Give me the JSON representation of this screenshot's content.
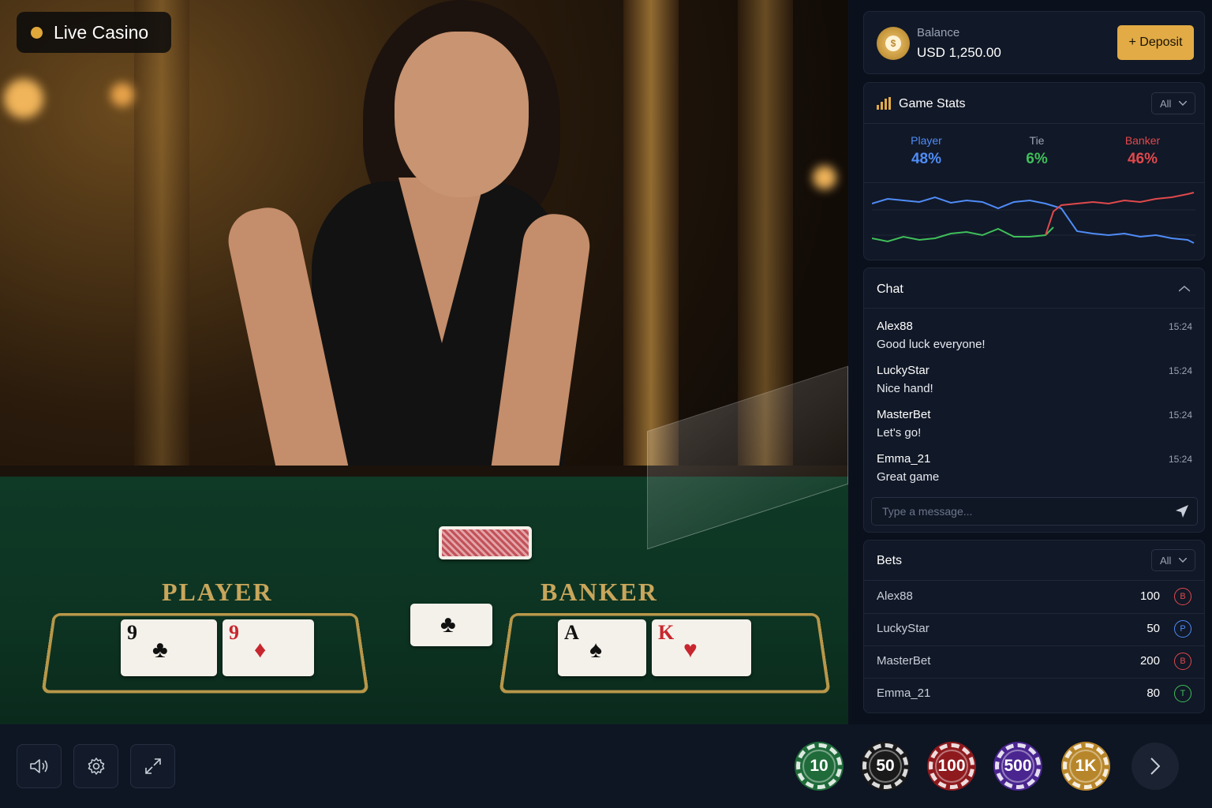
{
  "badge": {
    "label": "Live Casino",
    "dot_color": "#e0a83a"
  },
  "table": {
    "player_label": "PLAYER",
    "banker_label": "BANKER",
    "player_cards": [
      {
        "rank": "9",
        "suit": "♣",
        "color": "black"
      },
      {
        "rank": "9",
        "suit": "♦",
        "color": "red"
      }
    ],
    "banker_cards": [
      {
        "rank": "A",
        "suit": "♠",
        "color": "black"
      },
      {
        "rank": "K",
        "suit": "♥",
        "color": "red"
      }
    ],
    "dealt_card": {
      "rank": "",
      "suit": "♣",
      "color": "black"
    }
  },
  "balance": {
    "label": "Balance",
    "value": "USD 1,250.00",
    "coin_symbol": "$"
  },
  "deposit": {
    "label": "+ Deposit"
  },
  "stats": {
    "title": "Game Stats",
    "filter": "All",
    "player": {
      "name": "Player",
      "value": "48%",
      "color": "#4f8cf7"
    },
    "tie": {
      "name": "Tie",
      "value": "6%",
      "color": "#3fbf5a"
    },
    "banker": {
      "name": "Banker",
      "value": "46%",
      "color": "#e0494c"
    }
  },
  "chat": {
    "title": "Chat",
    "messages": [
      {
        "user": "Alex88",
        "text": "Good luck everyone!",
        "time": "15:24"
      },
      {
        "user": "LuckyStar",
        "text": "Nice hand!",
        "time": "15:24"
      },
      {
        "user": "MasterBet",
        "text": "Let's go!",
        "time": "15:24"
      },
      {
        "user": "Emma_21",
        "text": "Great game",
        "time": "15:24"
      }
    ],
    "input_placeholder": "Type a message..."
  },
  "bets": {
    "title": "Bets",
    "filter": "All",
    "rows": [
      {
        "user": "Alex88",
        "amount": "100",
        "tag": "B",
        "tag_color": "#e0494c"
      },
      {
        "user": "LuckyStar",
        "amount": "50",
        "tag": "P",
        "tag_color": "#4f8cf7"
      },
      {
        "user": "MasterBet",
        "amount": "200",
        "tag": "B",
        "tag_color": "#e0494c"
      },
      {
        "user": "Emma_21",
        "amount": "80",
        "tag": "T",
        "tag_color": "#3fbf5a"
      }
    ]
  },
  "controls": {
    "sound_icon": "speaker-icon",
    "settings_icon": "gear-icon",
    "fullscreen_icon": "expand-icon"
  },
  "chips": [
    {
      "label": "10",
      "color": "#1f6b3a"
    },
    {
      "label": "50",
      "color": "#1a1a1a"
    },
    {
      "label": "100",
      "color": "#8e1a1e"
    },
    {
      "label": "500",
      "color": "#4a2590"
    },
    {
      "label": "1K",
      "color": "#b8862a"
    }
  ]
}
